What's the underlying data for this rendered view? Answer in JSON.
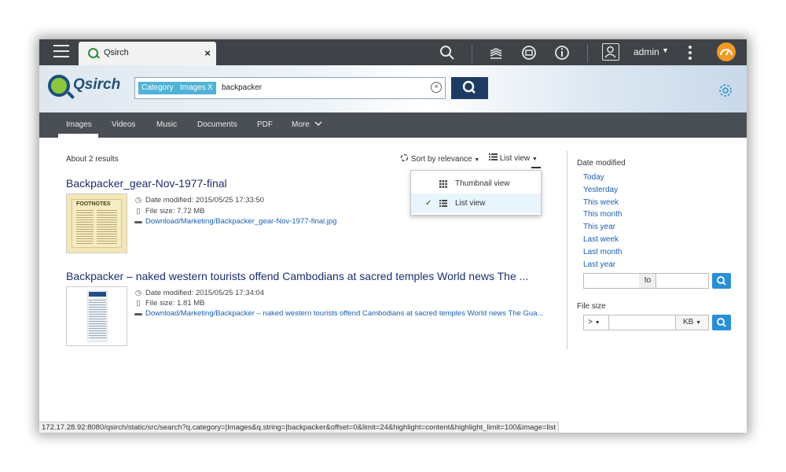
{
  "topbar": {
    "tab_title": "Qsirch",
    "tab_close": "×",
    "user_name": "admin",
    "icons": [
      "menu-icon",
      "search-icon",
      "stack-icon",
      "sync-icon",
      "info-icon",
      "user-icon",
      "more-icon",
      "dashboard-icon"
    ]
  },
  "header": {
    "logo_text": "Qsirch",
    "search": {
      "chip_category": "Category",
      "chip_images": "Images",
      "chip_remove": "X",
      "query": "backpacker"
    }
  },
  "nav": {
    "items": [
      "Images",
      "Videos",
      "Music",
      "Documents",
      "PDF",
      "More"
    ],
    "active": "Images"
  },
  "results": {
    "count_text": "About 2 results",
    "sort_label": "Sort by relevance",
    "view_label": "List view",
    "view_menu": [
      {
        "label": "Thumbnail view",
        "selected": false
      },
      {
        "label": "List view",
        "selected": true
      }
    ],
    "items": [
      {
        "title": "Backpacker_gear-Nov-1977-final",
        "date": "Date modified: 2015/05/25 17:33:50",
        "size": "File size: 7.72 MB",
        "path": "Download/Marketing/Backpacker_gear-Nov-1977-final.jpg",
        "thumb_text": "FOOTNOTES"
      },
      {
        "title": "Backpacker – naked western tourists offend Cambodians at sacred temples World news The ...",
        "date": "Date modified: 2015/05/25 17:34:04",
        "size": "File size: 1.81 MB",
        "path": "Download/Marketing/Backpacker – naked western tourists offend Cambodians at sacred temples World news The Gua...",
        "thumb_text": ""
      }
    ]
  },
  "sidebar": {
    "date_title": "Date modified",
    "date_links": [
      "Today",
      "Yesterday",
      "This week",
      "This month",
      "This year",
      "Last week",
      "Last month",
      "Last year"
    ],
    "range_to": "to",
    "size_title": "File size",
    "size_op": ">",
    "size_unit": "KB"
  },
  "status_url": "172.17.28.92:8080/qsirch/static/src/search?q.category=|Images&q.string=|backpacker&offset=0&limit=24&highlight=content&highlight_limit=100&image=list",
  "colors": {
    "topbar": "#3f4347",
    "nav": "#4a4f55",
    "search_button": "#1e3b63",
    "chip": "#4fb3d9",
    "link": "#1a5fb4",
    "title": "#1c2f6e",
    "accent_button": "#2b8fd6"
  }
}
